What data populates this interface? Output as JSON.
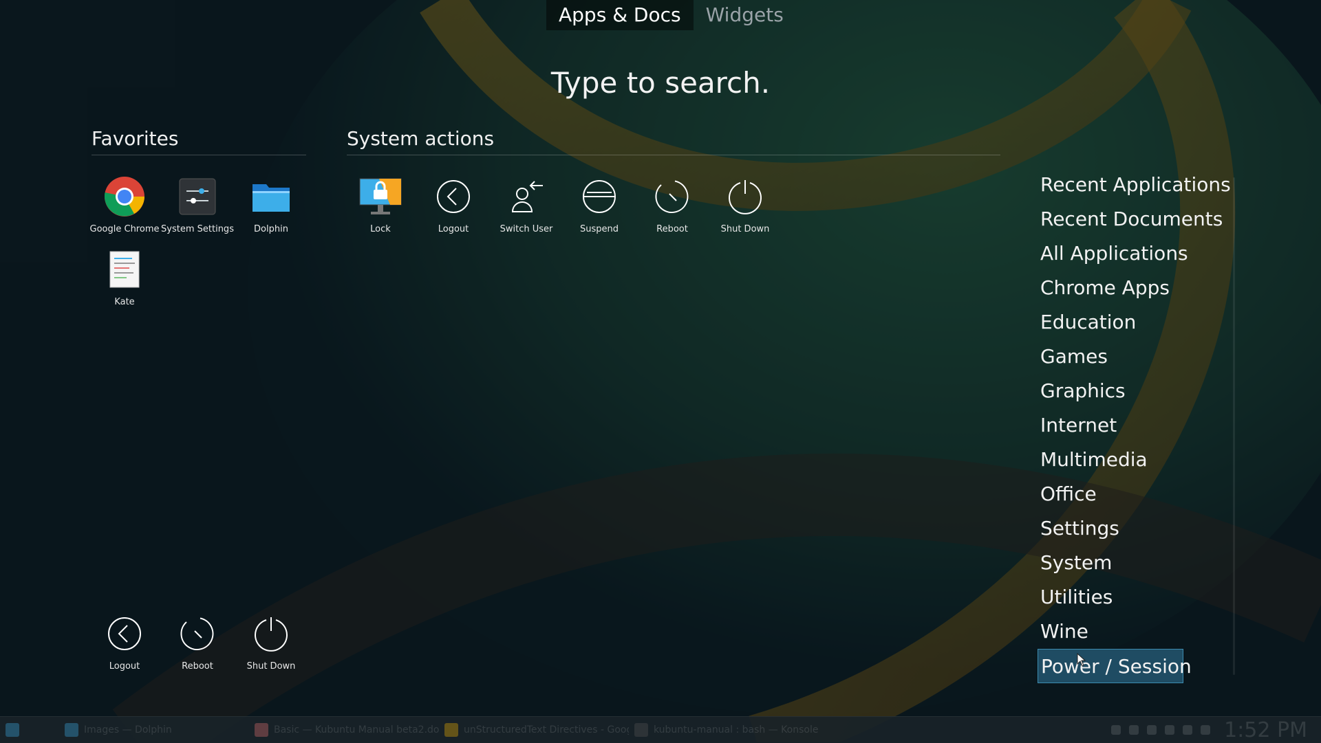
{
  "tabs": [
    {
      "label": "Apps & Docs",
      "active": true
    },
    {
      "label": "Widgets",
      "active": false
    }
  ],
  "search_hint": "Type to search.",
  "favorites": {
    "title": "Favorites",
    "items": [
      {
        "label": "Google Chrome",
        "icon": "chrome-icon"
      },
      {
        "label": "System Settings",
        "icon": "settings-icon"
      },
      {
        "label": "Dolphin",
        "icon": "folder-icon"
      },
      {
        "label": "Kate",
        "icon": "text-editor-icon"
      }
    ]
  },
  "system_actions": {
    "title": "System actions",
    "items": [
      {
        "label": "Lock",
        "icon": "lock-screen-icon"
      },
      {
        "label": "Logout",
        "icon": "logout-icon"
      },
      {
        "label": "Switch User",
        "icon": "switch-user-icon"
      },
      {
        "label": "Suspend",
        "icon": "suspend-icon"
      },
      {
        "label": "Reboot",
        "icon": "reboot-icon"
      },
      {
        "label": "Shut Down",
        "icon": "power-icon"
      }
    ]
  },
  "bottom_actions": [
    {
      "label": "Logout",
      "icon": "logout-icon"
    },
    {
      "label": "Reboot",
      "icon": "reboot-icon"
    },
    {
      "label": "Shut Down",
      "icon": "power-icon"
    }
  ],
  "categories": [
    "Recent Applications",
    "Recent Documents",
    "All Applications",
    "Chrome Apps",
    "Education",
    "Games",
    "Graphics",
    "Internet",
    "Multimedia",
    "Office",
    "Settings",
    "System",
    "Utilities",
    "Wine",
    "Power / Session"
  ],
  "selected_category": "Power / Session",
  "taskbar": {
    "windows": [
      "Images — Dolphin",
      "Basic — Kubuntu Manual beta2.do",
      "unStructuredText Directives - Goog",
      "kubuntu-manual : bash — Konsole"
    ],
    "clock": "1:52 PM"
  },
  "colors": {
    "selection_bg": "#1f4c63",
    "selection_border": "#3d8cb0",
    "wallpaper_green": "#1f5a3a",
    "wallpaper_gold": "#b8860b"
  }
}
